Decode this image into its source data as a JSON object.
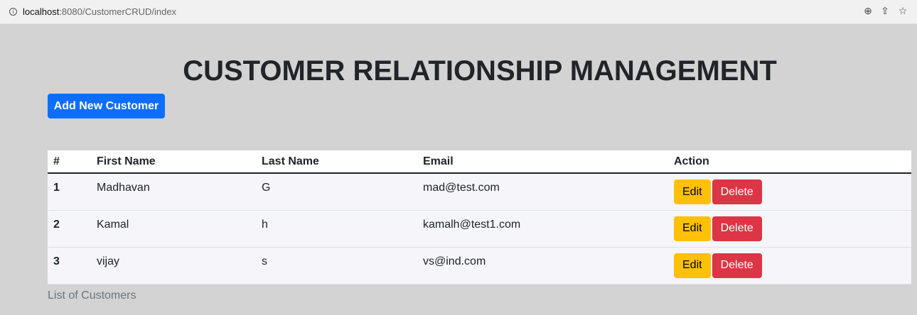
{
  "browser": {
    "host": "localhost",
    "path": ":8080/CustomerCRUD/index",
    "icons": [
      "info-icon",
      "zoom-icon",
      "share-icon",
      "star-icon"
    ]
  },
  "page": {
    "title": "CUSTOMER RELATIONSHIP MANAGEMENT",
    "add_button_label": "Add New Customer",
    "caption": "List of Customers"
  },
  "colors": {
    "primary": "#0d6efd",
    "warning": "#ffc107",
    "danger": "#dc3545",
    "background": "#d3d3d3"
  },
  "table": {
    "headers": [
      "#",
      "First Name",
      "Last Name",
      "Email",
      "Action"
    ],
    "rows": [
      {
        "id": "1",
        "first_name": "Madhavan",
        "last_name": "G",
        "email": "mad@test.com",
        "edit_label": "Edit",
        "delete_label": "Delete"
      },
      {
        "id": "2",
        "first_name": "Kamal",
        "last_name": "h",
        "email": "kamalh@test1.com",
        "edit_label": "Edit",
        "delete_label": "Delete"
      },
      {
        "id": "3",
        "first_name": "vijay",
        "last_name": "s",
        "email": "vs@ind.com",
        "edit_label": "Edit",
        "delete_label": "Delete"
      }
    ]
  }
}
